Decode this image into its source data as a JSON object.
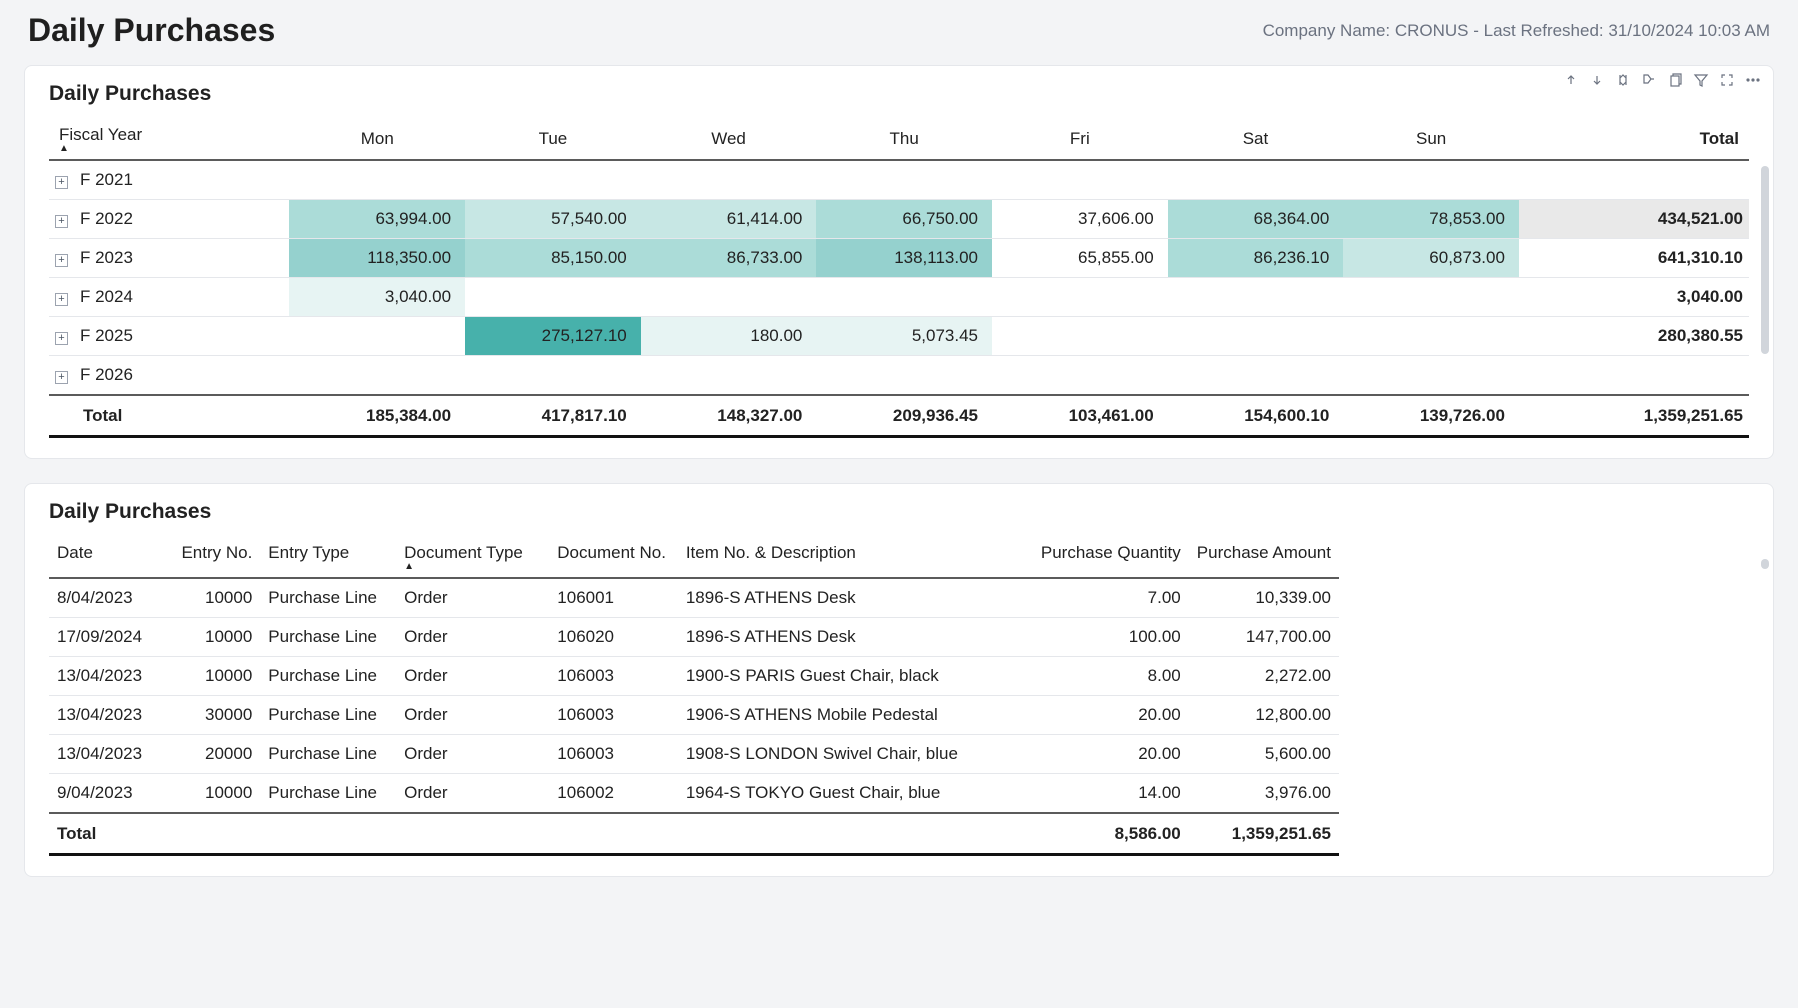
{
  "page": {
    "title": "Daily Purchases",
    "meta": "Company Name: CRONUS - Last Refreshed: 31/10/2024 10:03 AM"
  },
  "matrix": {
    "title": "Daily Purchases",
    "fiscal_year_label": "Fiscal Year",
    "days": [
      "Mon",
      "Tue",
      "Wed",
      "Thu",
      "Fri",
      "Sat",
      "Sun"
    ],
    "total_label": "Total",
    "rows": {
      "f2021": {
        "label": "F 2021"
      },
      "f2022": {
        "label": "F 2022",
        "mon": "63,994.00",
        "tue": "57,540.00",
        "wed": "61,414.00",
        "thu": "66,750.00",
        "fri": "37,606.00",
        "sat": "68,364.00",
        "sun": "78,853.00",
        "total": "434,521.00"
      },
      "f2023": {
        "label": "F 2023",
        "mon": "118,350.00",
        "tue": "85,150.00",
        "wed": "86,733.00",
        "thu": "138,113.00",
        "fri": "65,855.00",
        "sat": "86,236.10",
        "sun": "60,873.00",
        "total": "641,310.10"
      },
      "f2024": {
        "label": "F 2024",
        "mon": "3,040.00",
        "total": "3,040.00"
      },
      "f2025": {
        "label": "F 2025",
        "tue": "275,127.10",
        "wed": "180.00",
        "thu": "5,073.45",
        "total": "280,380.55"
      },
      "f2026": {
        "label": "F 2026"
      }
    },
    "totals": {
      "label": "Total",
      "mon": "185,384.00",
      "tue": "417,817.10",
      "wed": "148,327.00",
      "thu": "209,936.45",
      "fri": "103,461.00",
      "sat": "154,600.10",
      "sun": "139,726.00",
      "grand": "1,359,251.65"
    }
  },
  "detail": {
    "title": "Daily Purchases",
    "headers": {
      "date": "Date",
      "entry_no": "Entry No.",
      "entry_type": "Entry Type",
      "doc_type": "Document Type",
      "doc_no": "Document No.",
      "item": "Item No. & Description",
      "qty": "Purchase Quantity",
      "amt": "Purchase Amount"
    },
    "rows": [
      {
        "date": "8/04/2023",
        "entry_no": "10000",
        "entry_type": "Purchase Line",
        "doc_type": "Order",
        "doc_no": "106001",
        "item": "1896-S ATHENS Desk",
        "qty": "7.00",
        "amt": "10,339.00"
      },
      {
        "date": "17/09/2024",
        "entry_no": "10000",
        "entry_type": "Purchase Line",
        "doc_type": "Order",
        "doc_no": "106020",
        "item": "1896-S ATHENS Desk",
        "qty": "100.00",
        "amt": "147,700.00"
      },
      {
        "date": "13/04/2023",
        "entry_no": "10000",
        "entry_type": "Purchase Line",
        "doc_type": "Order",
        "doc_no": "106003",
        "item": "1900-S PARIS Guest Chair, black",
        "qty": "8.00",
        "amt": "2,272.00"
      },
      {
        "date": "13/04/2023",
        "entry_no": "30000",
        "entry_type": "Purchase Line",
        "doc_type": "Order",
        "doc_no": "106003",
        "item": "1906-S ATHENS Mobile Pedestal",
        "qty": "20.00",
        "amt": "12,800.00"
      },
      {
        "date": "13/04/2023",
        "entry_no": "20000",
        "entry_type": "Purchase Line",
        "doc_type": "Order",
        "doc_no": "106003",
        "item": "1908-S LONDON Swivel Chair, blue",
        "qty": "20.00",
        "amt": "5,600.00"
      },
      {
        "date": "9/04/2023",
        "entry_no": "10000",
        "entry_type": "Purchase Line",
        "doc_type": "Order",
        "doc_no": "106002",
        "item": "1964-S TOKYO Guest Chair, blue",
        "qty": "14.00",
        "amt": "3,976.00"
      }
    ],
    "totals": {
      "label": "Total",
      "qty": "8,586.00",
      "amt": "1,359,251.65"
    }
  }
}
